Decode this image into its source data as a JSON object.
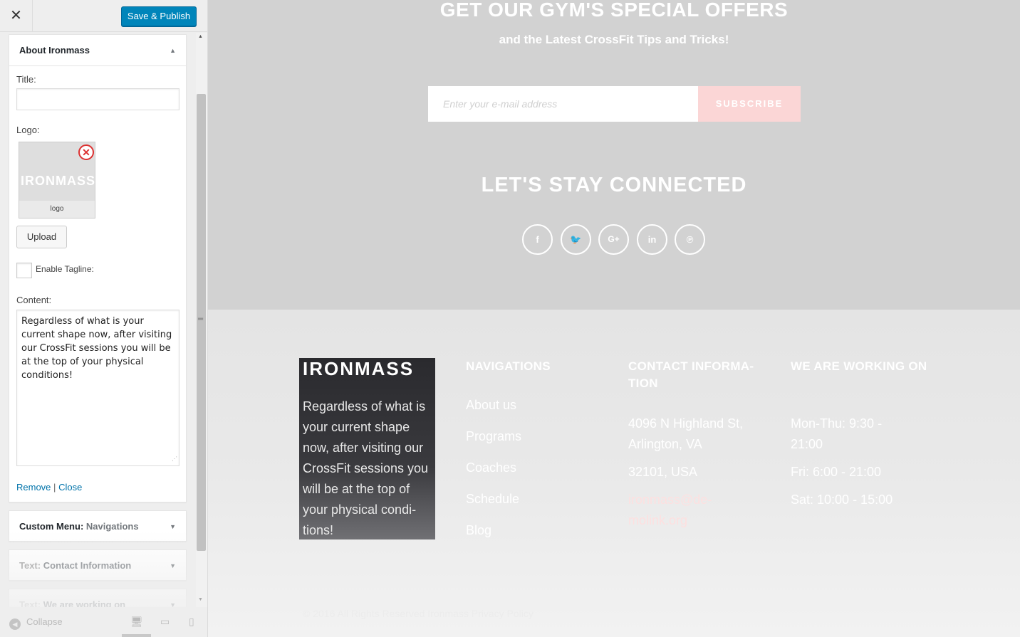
{
  "sidebar": {
    "close_icon": "✕",
    "save_label": "Save & Publish",
    "widgets": {
      "about": {
        "title": "About Ironmass",
        "title_label": "Title:",
        "title_value": "",
        "logo_label": "Logo:",
        "logo_image_text": "IRONMASS",
        "logo_caption": "logo",
        "remove_icon": "✕",
        "upload_label": "Upload",
        "tagline_label": "Enable Tagline:",
        "content_label": "Content:",
        "content_value": "Regardless of what is your current shape now, after visiting our CrossFit sessions you will be at the top of your physical conditions!",
        "remove_link": "Remove",
        "separator": "|",
        "close_link": "Close"
      },
      "menu": {
        "prefix": "Custom Menu:",
        "name": "Navigations"
      },
      "contact": {
        "prefix": "Text:",
        "name": "Contact Information"
      },
      "working": {
        "prefix": "Text:",
        "name": "We are working on"
      }
    },
    "footer": {
      "collapse_label": "Collapse",
      "devices": [
        "desktop",
        "tablet",
        "mobile"
      ]
    },
    "colors": {
      "primary_button": "#0085ba",
      "link": "#0073aa",
      "remove_icon": "#dc3232"
    }
  },
  "preview": {
    "offers_title": "GET OUR GYM'S SPECIAL OFFERS",
    "offers_subtitle": "and the Latest CrossFit Tips and Tricks!",
    "email_placeholder": "Enter your e-mail address",
    "subscribe_label": "SUBSCRIBE",
    "connect_title": "LET'S STAY CONNECTED",
    "social": [
      {
        "name": "facebook-icon",
        "glyph": "f"
      },
      {
        "name": "twitter-icon",
        "glyph": "🐦"
      },
      {
        "name": "google-plus-icon",
        "glyph": "G+"
      },
      {
        "name": "linkedin-icon",
        "glyph": "in"
      },
      {
        "name": "pinterest-icon",
        "glyph": "℗"
      }
    ],
    "footer": {
      "logo": "IRONMASS",
      "about_text": "Regardless of what is your current shape now, after visiting our CrossFit sessions you will be at the top of your physical condi- tions!",
      "nav_heading": "NAVIGATIONS",
      "nav_links": [
        "About us",
        "Programs",
        "Coaches",
        "Schedule",
        "Blog"
      ],
      "contact_heading": "CONTACT INFORMA- TION",
      "contact_address": "4096 N Highland St, Arlington, VA",
      "contact_zip": "32101, USA",
      "contact_email": "ironmass@de- molink.org",
      "work_heading": "WE ARE WORKING ON",
      "work_hours": [
        "Mon-Thu: 9:30 - 21:00",
        "Fri: 6:00 - 21:00",
        "Sat: 10:00 - 15:00"
      ],
      "copyright": "© 2016 All Rights Reserved Ironmass Privacy Policy"
    },
    "colors": {
      "subscribe_button": "#fbd6d6",
      "about_panel": "#2a2a2e",
      "background": "#d2d2d2"
    }
  }
}
